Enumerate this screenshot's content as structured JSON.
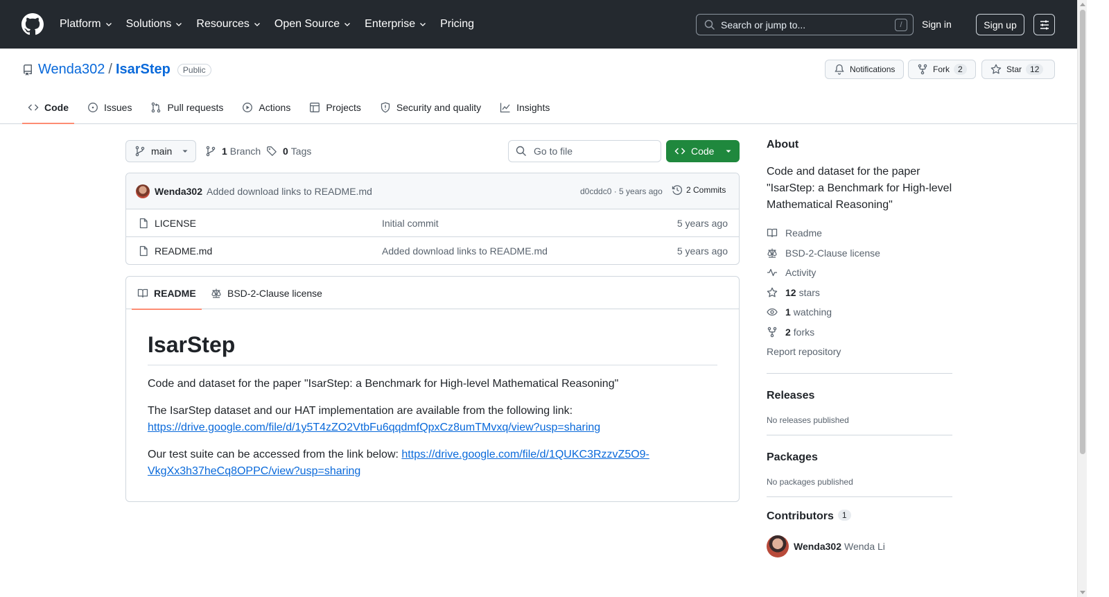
{
  "header": {
    "nav": [
      "Platform",
      "Solutions",
      "Resources",
      "Open Source",
      "Enterprise",
      "Pricing"
    ],
    "search_placeholder": "Search or jump to...",
    "search_shortcut": "/",
    "sign_in": "Sign in",
    "sign_up": "Sign up"
  },
  "repo": {
    "owner": "Wenda302",
    "separator": "/",
    "name": "IsarStep",
    "visibility": "Public",
    "notifications_label": "Notifications",
    "fork_label": "Fork",
    "fork_count": "2",
    "star_label": "Star",
    "star_count": "12"
  },
  "tabs": [
    "Code",
    "Issues",
    "Pull requests",
    "Actions",
    "Projects",
    "Security and quality",
    "Insights"
  ],
  "toolbar": {
    "branch": "main",
    "branch_count": "1",
    "branch_label": "Branch",
    "tag_count": "0",
    "tag_label": "Tags",
    "go_to_file": "Go to file",
    "code_button": "Code"
  },
  "latest_commit": {
    "author": "Wenda302",
    "message": "Added download links to README.md",
    "sha_age": "d0cddc0 · 5 years ago",
    "commits": "2 Commits"
  },
  "files": [
    {
      "name": "LICENSE",
      "message": "Initial commit",
      "age": "5 years ago"
    },
    {
      "name": "README.md",
      "message": "Added download links to README.md",
      "age": "5 years ago"
    }
  ],
  "readme": {
    "tab_readme": "README",
    "tab_license": "BSD-2-Clause license",
    "title": "IsarStep",
    "p1": "Code and dataset for the paper \"IsarStep: a Benchmark for High-level Mathematical Reasoning\"",
    "p2_text": "The IsarStep dataset and our HAT implementation are available from the following link:",
    "p2_link": "https://drive.google.com/file/d/1y5T4zZO2VtbFu6qqdmfQpxCz8umTMvxq/view?usp=sharing",
    "p3_text": "Our test suite can be accessed from the link below:",
    "p3_link": "https://drive.google.com/file/d/1QUKC3RzzvZ5O9-VkgXx3h37heCq8OPPC/view?usp=sharing"
  },
  "sidebar": {
    "about_title": "About",
    "about_desc": "Code and dataset for the paper \"IsarStep: a Benchmark for High-level Mathematical Reasoning\"",
    "readme": "Readme",
    "license": "BSD-2-Clause license",
    "activity": "Activity",
    "stars_count": "12",
    "stars_label": "stars",
    "watching_count": "1",
    "watching_label": "watching",
    "forks_count": "2",
    "forks_label": "forks",
    "report": "Report repository",
    "releases_title": "Releases",
    "releases_text": "No releases published",
    "packages_title": "Packages",
    "packages_text": "No packages published",
    "contributors_title": "Contributors",
    "contributors_count": "1",
    "contributor_login": "Wenda302",
    "contributor_name": "Wenda Li"
  },
  "colors": {
    "header_bg": "#24292f",
    "link": "#0969da",
    "primary_button": "#1f883d",
    "active_tab_underline": "#fd8c73"
  }
}
